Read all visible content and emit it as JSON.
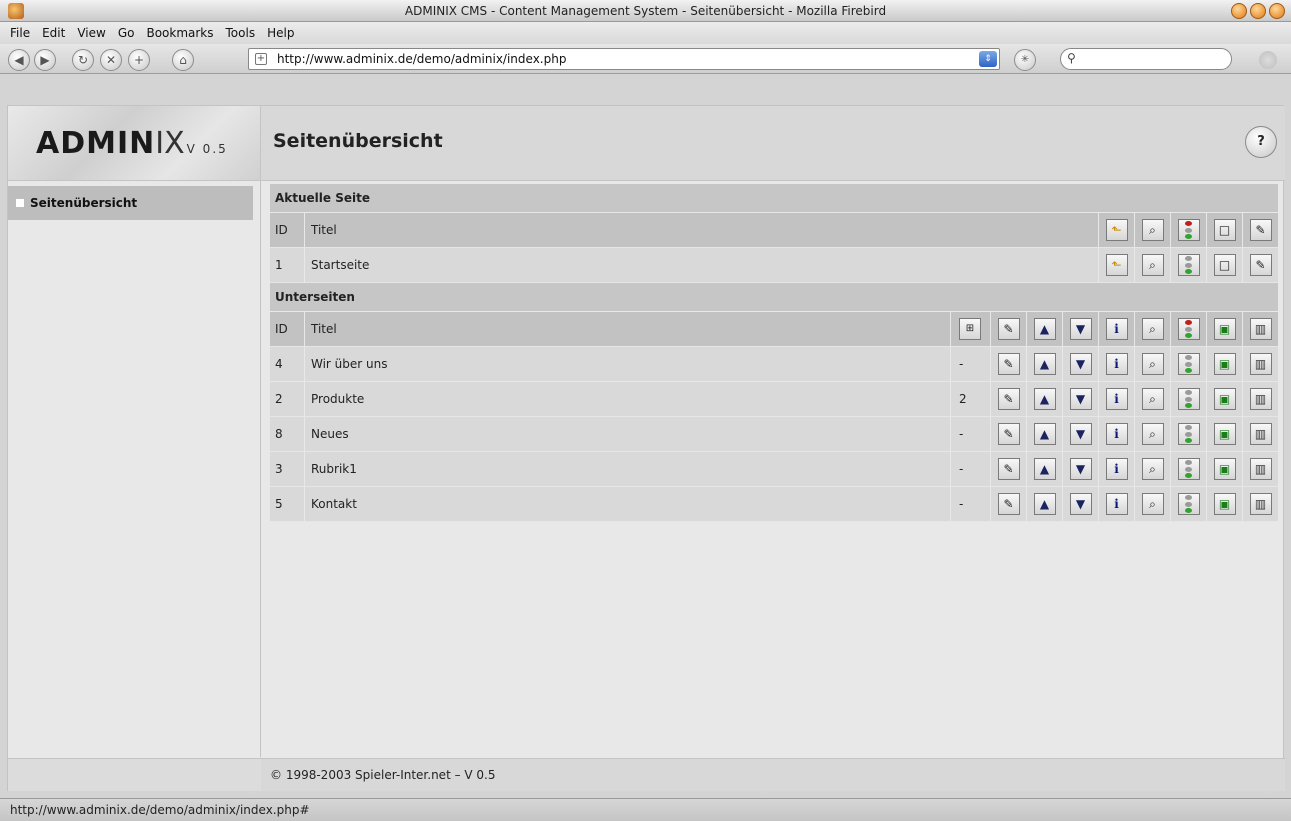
{
  "window": {
    "title": "ADMINIX CMS - Content Management System - Seitenübersicht - Mozilla Firebird"
  },
  "menu": [
    "File",
    "Edit",
    "View",
    "Go",
    "Bookmarks",
    "Tools",
    "Help"
  ],
  "address": {
    "url": "http://www.adminix.de/demo/adminix/index.php"
  },
  "logo": {
    "text": "ADMIN",
    "ix": "IX",
    "version": "V 0.5"
  },
  "header": {
    "title": "Seitenübersicht",
    "help": "?"
  },
  "sidebar": {
    "items": [
      {
        "label": "Seitenübersicht"
      }
    ]
  },
  "current": {
    "heading": "Aktuelle Seite",
    "col_id": "ID",
    "col_title": "Titel",
    "row": {
      "id": "1",
      "title": "Startseite"
    }
  },
  "subpages": {
    "heading": "Unterseiten",
    "col_id": "ID",
    "col_title": "Titel",
    "rows": [
      {
        "id": "4",
        "title": "Wir über uns",
        "sub": "-"
      },
      {
        "id": "2",
        "title": "Produkte",
        "sub": "2"
      },
      {
        "id": "8",
        "title": "Neues",
        "sub": "-"
      },
      {
        "id": "3",
        "title": "Rubrik1",
        "sub": "-"
      },
      {
        "id": "5",
        "title": "Kontakt",
        "sub": "-"
      }
    ]
  },
  "icons": {
    "current": [
      "up-folder-icon",
      "preview-icon",
      "status-light-icon",
      "new-page-icon",
      "edit-icon"
    ],
    "sub": [
      "edit-icon",
      "move-up-icon",
      "move-down-icon",
      "info-icon",
      "preview-icon",
      "status-light-icon",
      "publish-icon",
      "delete-icon"
    ]
  },
  "colors": {
    "light_red": "#c0201a",
    "light_green": "#2fa42f",
    "light_off": "#9a9a9a"
  },
  "footer": {
    "text": "© 1998-2003 Spieler-Inter.net – V 0.5"
  },
  "status": {
    "text": "http://www.adminix.de/demo/adminix/index.php#"
  }
}
